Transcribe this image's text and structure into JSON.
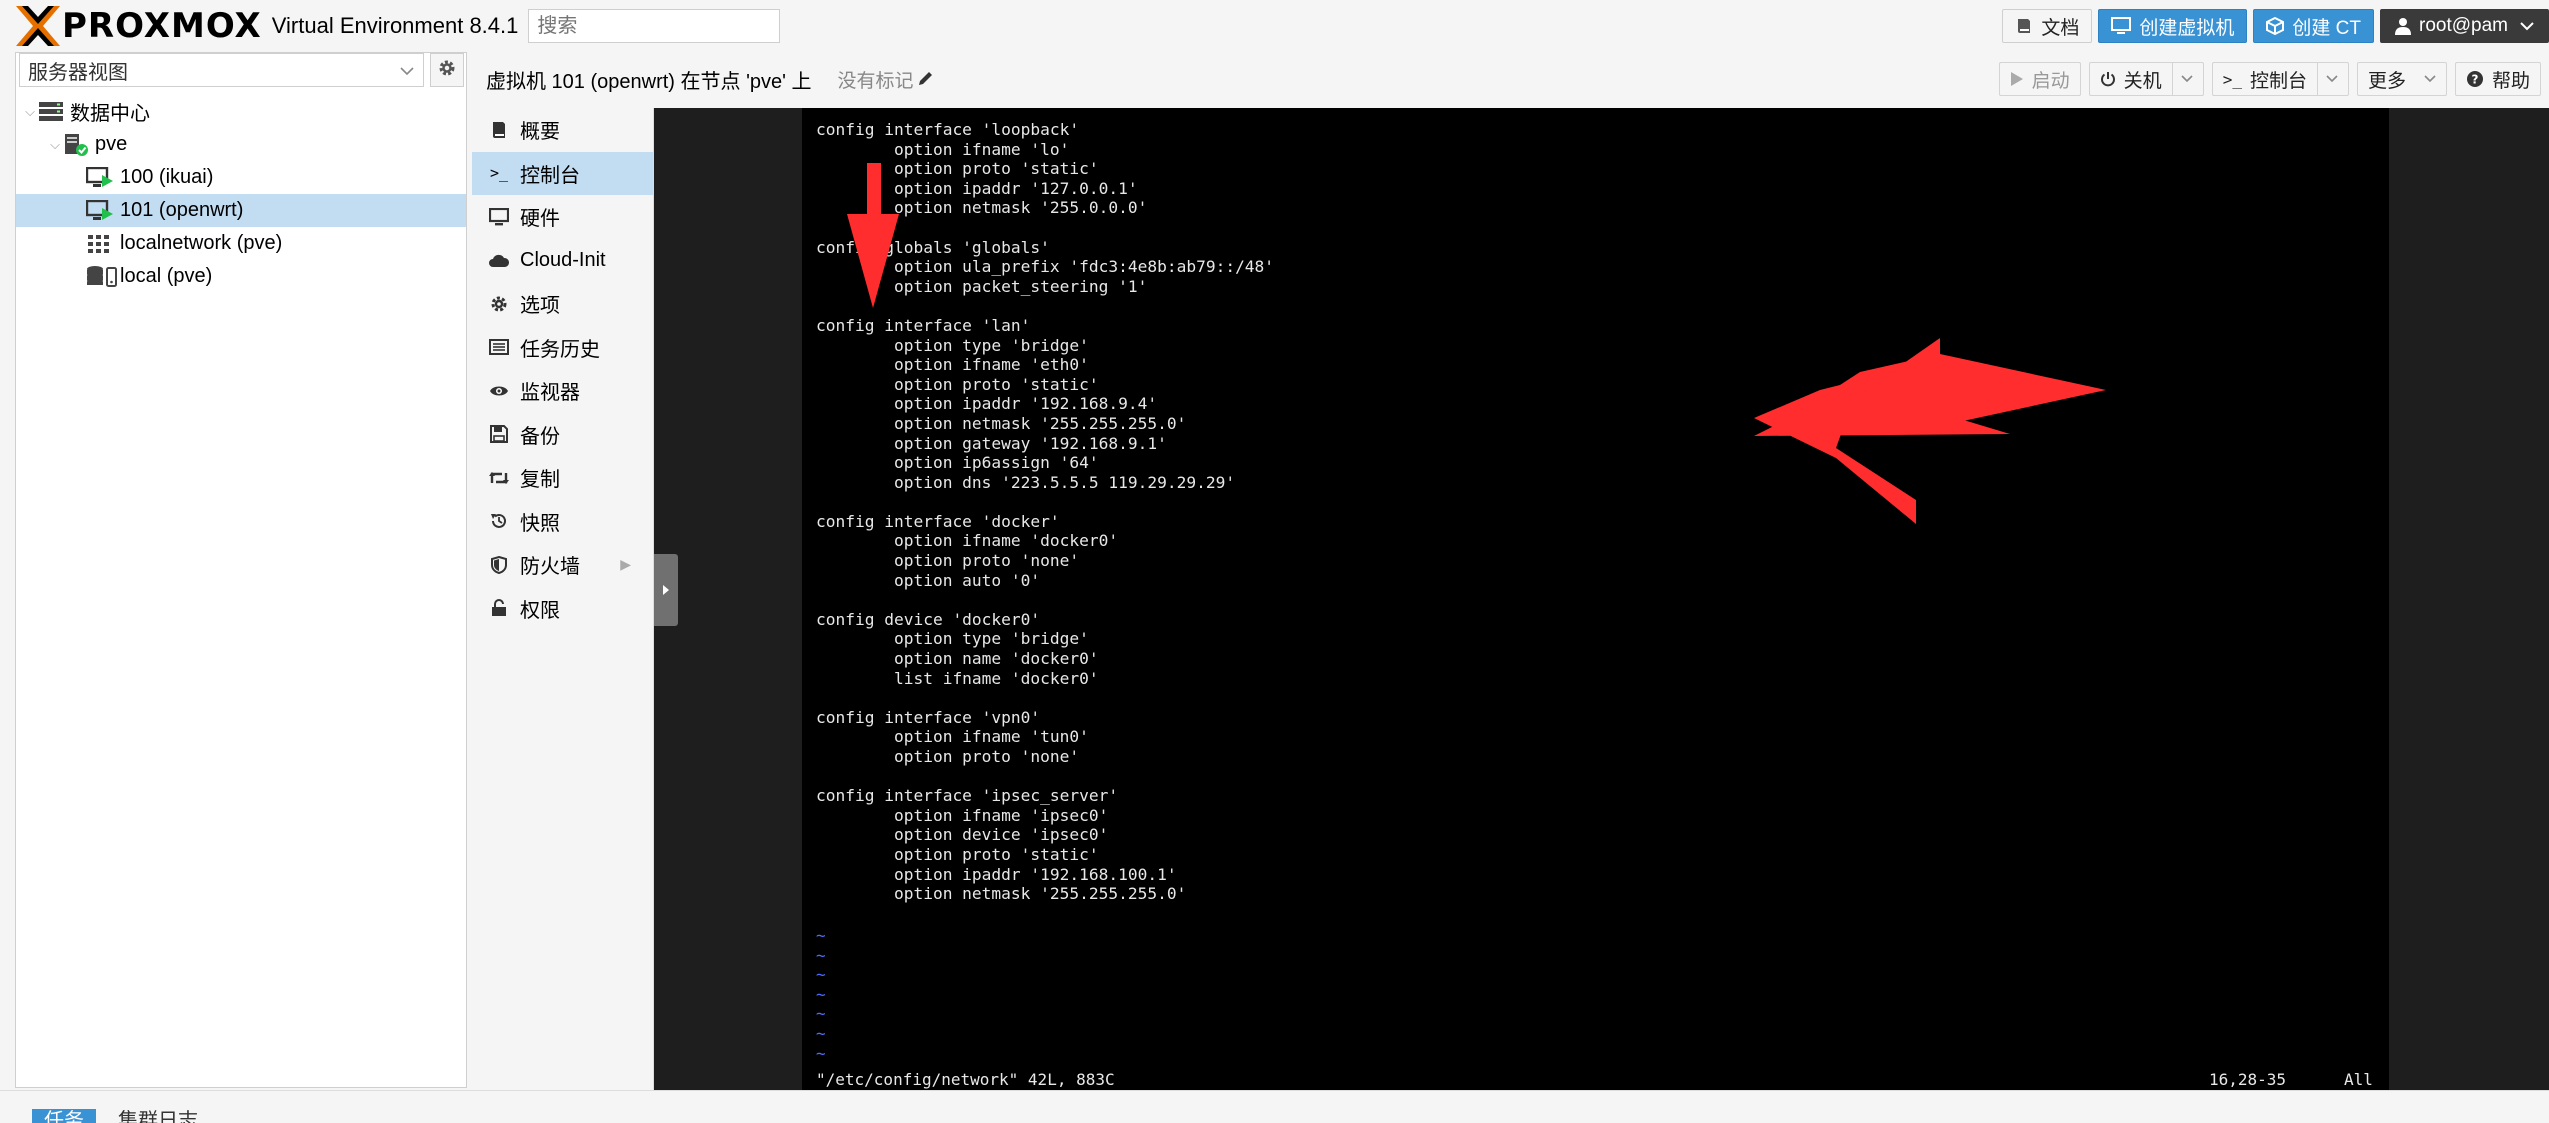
{
  "app": {
    "logo_text": "PROXMOX",
    "product": "Virtual Environment 8.4.1",
    "search_placeholder": "搜索"
  },
  "topbar": {
    "docs": "文档",
    "create_vm": "创建虚拟机",
    "create_ct": "创建 CT",
    "user": "root@pam"
  },
  "left": {
    "view_selector": "服务器视图",
    "tree": [
      {
        "label": "数据中心"
      },
      {
        "label": "pve"
      },
      {
        "label": "100 (ikuai)"
      },
      {
        "label": "101 (openwrt)"
      },
      {
        "label": "localnetwork (pve)"
      },
      {
        "label": "local (pve)"
      }
    ]
  },
  "vm": {
    "title": "虚拟机 101 (openwrt) 在节点 'pve' 上",
    "tags": "没有标记",
    "actions": {
      "start": "启动",
      "shutdown": "关机",
      "console": "控制台",
      "more": "更多",
      "help": "帮助"
    },
    "nav": [
      {
        "label": "概要"
      },
      {
        "label": "控制台"
      },
      {
        "label": "硬件"
      },
      {
        "label": "Cloud-Init"
      },
      {
        "label": "选项"
      },
      {
        "label": "任务历史"
      },
      {
        "label": "监视器"
      },
      {
        "label": "备份"
      },
      {
        "label": "复制"
      },
      {
        "label": "快照"
      },
      {
        "label": "防火墙"
      },
      {
        "label": "权限"
      }
    ]
  },
  "terminal": {
    "text": "config interface 'loopback'\n        option ifname 'lo'\n        option proto 'static'\n        option ipaddr '127.0.0.1'\n        option netmask '255.0.0.0'\n\nconfig globals 'globals'\n        option ula_prefix 'fdc3:4e8b:ab79::/48'\n        option packet_steering '1'\n\nconfig interface 'lan'\n        option type 'bridge'\n        option ifname 'eth0'\n        option proto 'static'\n        option ipaddr '192.168.9.4'\n        option netmask '255.255.255.0'\n        option gateway '192.168.9.1'\n        option ip6assign '64'\n        option dns '223.5.5.5 119.29.29.29'\n\nconfig interface 'docker'\n        option ifname 'docker0'\n        option proto 'none'\n        option auto '0'\n\nconfig device 'docker0'\n        option type 'bridge'\n        option name 'docker0'\n        list ifname 'docker0'\n\nconfig interface 'vpn0'\n        option ifname 'tun0'\n        option proto 'none'\n\nconfig interface 'ipsec_server'\n        option ifname 'ipsec0'\n        option device 'ipsec0'\n        option proto 'static'\n        option ipaddr '192.168.100.1'\n        option netmask '255.255.255.0'",
    "tildes": "~\n~\n~\n~\n~\n~\n~",
    "status_file": "\"/etc/config/network\" 42L, 883C",
    "status_pos": "16,28-35",
    "status_all": "All"
  },
  "bottom": {
    "tasks": "任务",
    "cluster_log": "集群日志"
  },
  "colors": {
    "accent": "#3892d4",
    "selection": "#c2dcf2",
    "arrow": "#ff2d2d",
    "logo_orange": "#e57000"
  },
  "icons": [
    "book-icon",
    "monitor-icon",
    "cube-icon",
    "user-icon",
    "gear-icon",
    "chevron-down-icon",
    "play-icon",
    "power-icon",
    "terminal-icon",
    "question-icon",
    "pencil-icon",
    "server-icon",
    "vm-icon",
    "network-grid-icon",
    "storage-icon",
    "shield-icon",
    "lock-icon",
    "clock-icon",
    "eye-icon",
    "save-icon",
    "retweet-icon",
    "history-icon",
    "list-icon",
    "cloud-icon"
  ]
}
